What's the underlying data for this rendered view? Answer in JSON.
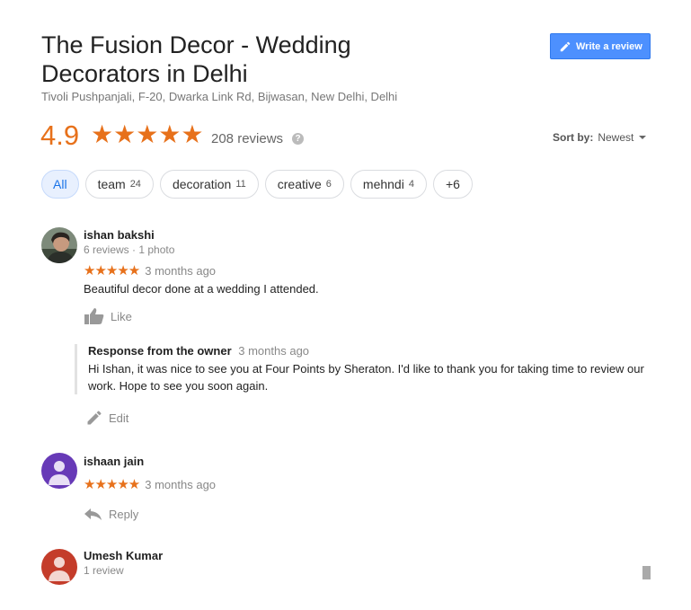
{
  "business": {
    "name": "The Fusion Decor - Wedding Decorators in Delhi",
    "address": "Tivoli Pushpanjali, F-20, Dwarka Link Rd, Bijwasan, New Delhi, Delhi",
    "rating": "4.9",
    "stars": "★★★★★",
    "review_count": "208 reviews",
    "help": "?"
  },
  "write_review_label": "Write a review",
  "sort": {
    "label": "Sort by:",
    "value": "Newest"
  },
  "chips": [
    {
      "label": "All",
      "count": ""
    },
    {
      "label": "team",
      "count": "24"
    },
    {
      "label": "decoration",
      "count": "11"
    },
    {
      "label": "creative",
      "count": "6"
    },
    {
      "label": "mehndi",
      "count": "4"
    },
    {
      "label": "+6",
      "count": ""
    }
  ],
  "reviews": [
    {
      "name": "ishan bakshi",
      "meta": "6 reviews · 1 photo",
      "stars": "★★★★★",
      "time": "3 months ago",
      "text": "Beautiful decor done at a wedding I attended.",
      "action": "Like",
      "owner_response": {
        "label": "Response from the owner",
        "time": "3 months ago",
        "text": "Hi Ishan, it was nice to see you at Four Points by Sheraton. I'd like to thank you for taking time to review our work. Hope to see you soon again.",
        "action": "Edit"
      }
    },
    {
      "name": "ishaan jain",
      "stars": "★★★★★",
      "time": "3 months ago",
      "action": "Reply",
      "avatar_color": "#673ab7"
    },
    {
      "name": "Umesh Kumar",
      "meta": "1 review",
      "avatar_color": "#c43c2a"
    }
  ],
  "colors": {
    "accent": "#e7711b",
    "button": "#4d90fe",
    "chip_active": "#e8f0fe"
  }
}
